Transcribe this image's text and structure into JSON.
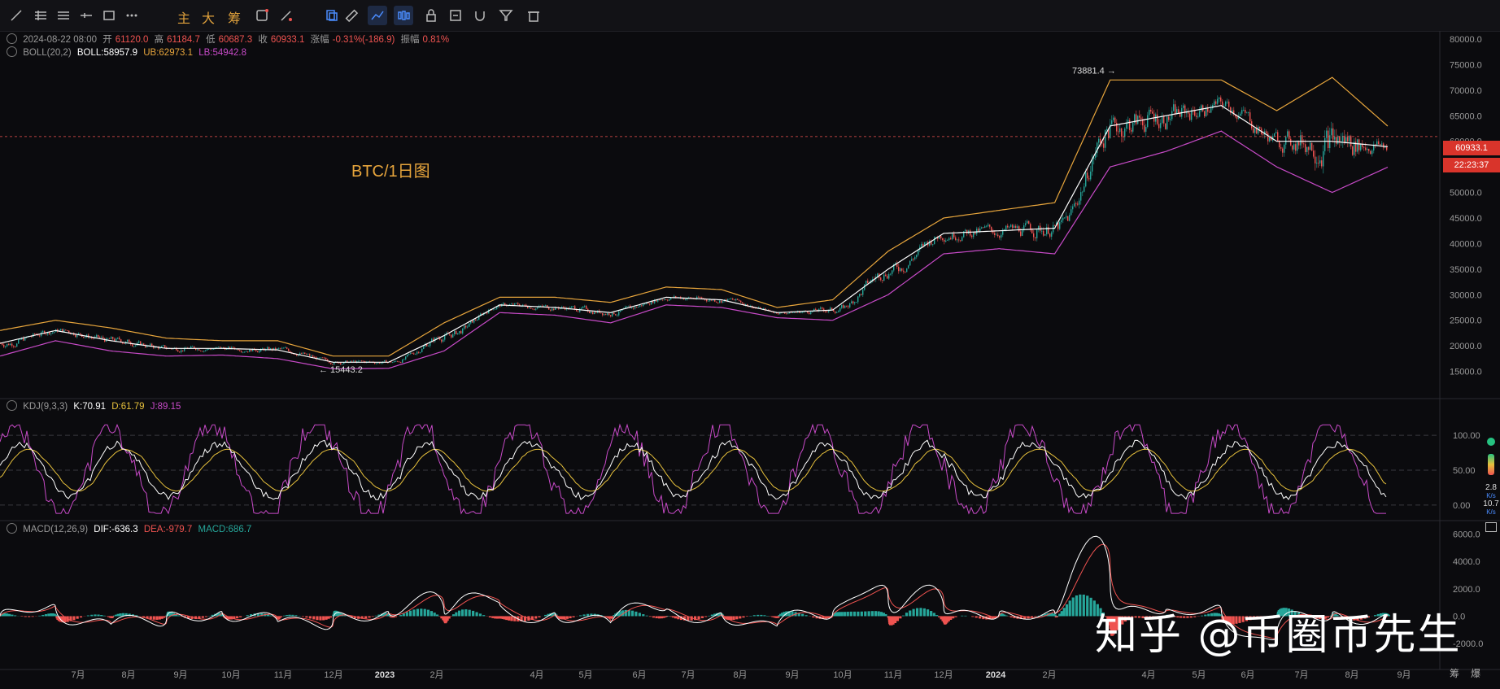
{
  "toolbar": {
    "left_tools": [
      "line-tool-icon",
      "hline-multi-icon",
      "parallel-lines-icon",
      "horizontal-ray-icon",
      "rectangle-icon",
      "more-icon"
    ],
    "cn_labels": [
      "主",
      "大",
      "筹"
    ],
    "right_tools": [
      "copy-icon",
      "ruler-icon",
      "draw-indicator-icon",
      "candles-icon",
      "lock-icon",
      "note-icon",
      "magnet-icon",
      "filter-icon",
      "trash-icon"
    ]
  },
  "header": {
    "datetime": "2024-08-22 08:00",
    "open_label": "开",
    "open": "61120.0",
    "high_label": "高",
    "high": "61184.7",
    "low_label": "低",
    "low": "60687.3",
    "close_label": "收",
    "close": "60933.1",
    "change_label": "涨幅",
    "change": "-0.31%(-186.9)",
    "amp_label": "振幅",
    "amp": "0.81%"
  },
  "boll": {
    "name": "BOLL(20,2)",
    "boll": "BOLL:58957.9",
    "ub": "UB:62973.1",
    "lb": "LB:54942.8"
  },
  "kdj": {
    "name": "KDJ(9,3,3)",
    "k": "K:70.91",
    "d": "D:61.79",
    "j": "J:89.15"
  },
  "macd": {
    "name": "MACD(12,26,9)",
    "dif": "DIF:-636.3",
    "dea": "DEA:-979.7",
    "macd": "MACD:686.7"
  },
  "overlay_label": "BTC/1日图",
  "price_tags": {
    "last": "60933.1",
    "countdown": "22:23:37"
  },
  "annotations": {
    "high_mark": "73881.4",
    "low_mark": "15443.2"
  },
  "right_panel": {
    "up_speed": "2.8",
    "up_unit": "K/s",
    "down_speed": "10.7",
    "down_unit": "K/s"
  },
  "bottom_right": [
    "筹",
    "爆"
  ],
  "watermark": "知乎 @币圈币先生",
  "colors": {
    "up": "#26a69a",
    "down": "#ef5350",
    "mid": "#ffffff",
    "ub": "#e7a53c",
    "lb": "#c74ac7",
    "k": "#ffffff",
    "d": "#e7c13c",
    "j": "#c74ac7",
    "dif": "#ffffff",
    "dea": "#ef5350",
    "price_line": "#ef5350"
  },
  "chart_data": [
    {
      "type": "line",
      "title": "BTC/1日图",
      "panel": "price",
      "x": [
        "7月",
        "8月",
        "9月",
        "10月",
        "11月",
        "12月",
        "2023",
        "2月",
        "4月",
        "5月",
        "6月",
        "7月",
        "8月",
        "9月",
        "10月",
        "11月",
        "12月",
        "2024",
        "2月",
        "4月",
        "5月",
        "6月",
        "7月",
        "8月",
        "9月"
      ],
      "y_ticks": [
        15000,
        20000,
        25000,
        30000,
        35000,
        40000,
        45000,
        50000,
        55000,
        60000,
        65000,
        70000,
        75000,
        80000
      ],
      "ylim": [
        10000,
        80000
      ],
      "series": [
        {
          "name": "BOLL",
          "values": [
            20500,
            23000,
            21000,
            19500,
            19500,
            19200,
            16800,
            16800,
            22000,
            28000,
            27500,
            26500,
            29500,
            29000,
            26500,
            27000,
            35000,
            42000,
            42500,
            43000,
            63000,
            65000,
            67000,
            60000,
            60000,
            58957.9
          ]
        },
        {
          "name": "UB",
          "values": [
            23000,
            25000,
            23500,
            21500,
            21000,
            21000,
            18000,
            18000,
            24500,
            29500,
            29500,
            28500,
            31500,
            31000,
            27500,
            29000,
            38500,
            45000,
            46500,
            48000,
            72000,
            72000,
            72000,
            66000,
            72500,
            62973.1
          ]
        },
        {
          "name": "LB",
          "values": [
            18000,
            21000,
            19000,
            18000,
            18200,
            17500,
            15500,
            15600,
            19000,
            26500,
            26000,
            24500,
            28000,
            27500,
            25500,
            25000,
            30000,
            38000,
            39000,
            38000,
            55000,
            58000,
            62000,
            55000,
            50000,
            54942.8
          ]
        }
      ],
      "annotations": [
        {
          "label": "73881.4"
        },
        {
          "label": "15443.2"
        }
      ]
    },
    {
      "type": "line",
      "panel": "KDJ",
      "y_ticks": [
        0,
        50,
        100
      ],
      "ylim": [
        -20,
        120
      ],
      "series": [
        {
          "name": "K",
          "values": [
            70.91
          ]
        },
        {
          "name": "D",
          "values": [
            61.79
          ]
        },
        {
          "name": "J",
          "values": [
            89.15
          ]
        }
      ]
    },
    {
      "type": "bar",
      "panel": "MACD",
      "y_ticks": [
        -2000,
        0,
        2000,
        4000,
        6000
      ],
      "ylim": [
        -3000,
        6500
      ],
      "series": [
        {
          "name": "DIF",
          "values": [
            -636.3
          ]
        },
        {
          "name": "DEA",
          "values": [
            -979.7
          ]
        },
        {
          "name": "MACD",
          "values": [
            686.7
          ]
        }
      ]
    }
  ]
}
